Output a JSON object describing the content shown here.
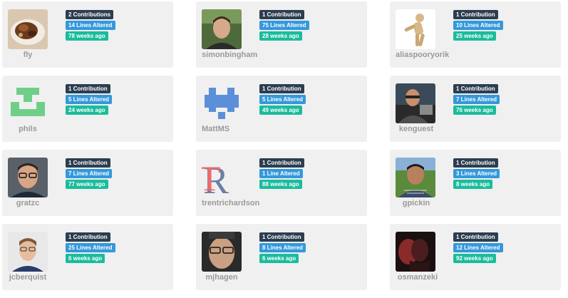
{
  "contributors": [
    {
      "username": "fly",
      "contributions": "2 Contributions",
      "lines": "14 Lines Altered",
      "last": "78 weeks ago",
      "avatar": "food-photo"
    },
    {
      "username": "simonbingham",
      "contributions": "1 Contribution",
      "lines": "75 Lines Altered",
      "last": "28 weeks ago",
      "avatar": "portrait-photo"
    },
    {
      "username": "aliaspooryorik",
      "contributions": "1 Contribution",
      "lines": "10 Lines Altered",
      "last": "25 weeks ago",
      "avatar": "wooden-mannequin"
    },
    {
      "username": "phils",
      "contributions": "1 Contribution",
      "lines": "5 Lines Altered",
      "last": "24 weeks ago",
      "avatar": "identicon",
      "identicon_color": "#6fcf8a"
    },
    {
      "username": "MattMS",
      "contributions": "1 Contribution",
      "lines": "5 Lines Altered",
      "last": "49 weeks ago",
      "avatar": "identicon",
      "identicon_color": "#5b8fd8"
    },
    {
      "username": "kenguest",
      "contributions": "1 Contribution",
      "lines": "7 Lines Altered",
      "last": "76 weeks ago",
      "avatar": "portrait-photo"
    },
    {
      "username": "gratzc",
      "contributions": "1 Contribution",
      "lines": "7 Lines Altered",
      "last": "77 weeks ago",
      "avatar": "portrait-photo"
    },
    {
      "username": "trentrichardson",
      "contributions": "1 Contribution",
      "lines": "1 Line Altered",
      "last": "88 weeks ago",
      "avatar": "tr-logo"
    },
    {
      "username": "gpickin",
      "contributions": "1 Contribution",
      "lines": "3 Lines Altered",
      "last": "8 weeks ago",
      "avatar": "portrait-photo"
    },
    {
      "username": "jcberquist",
      "contributions": "1 Contribution",
      "lines": "25 Lines Altered",
      "last": "6 weeks ago",
      "avatar": "portrait-photo"
    },
    {
      "username": "mjhagen",
      "contributions": "1 Contribution",
      "lines": "8 Lines Altered",
      "last": "6 weeks ago",
      "avatar": "portrait-photo"
    },
    {
      "username": "osmanzeki",
      "contributions": "1 Contribution",
      "lines": "12 Lines Altered",
      "last": "92 weeks ago",
      "avatar": "portrait-photo"
    }
  ],
  "logo_text": "TR",
  "colors": {
    "contributions_badge": "#2c3e50",
    "lines_badge": "#3498db",
    "weeks_badge": "#1abc9c",
    "card_bg": "#f0f0f0",
    "username": "#9a9a9a"
  }
}
